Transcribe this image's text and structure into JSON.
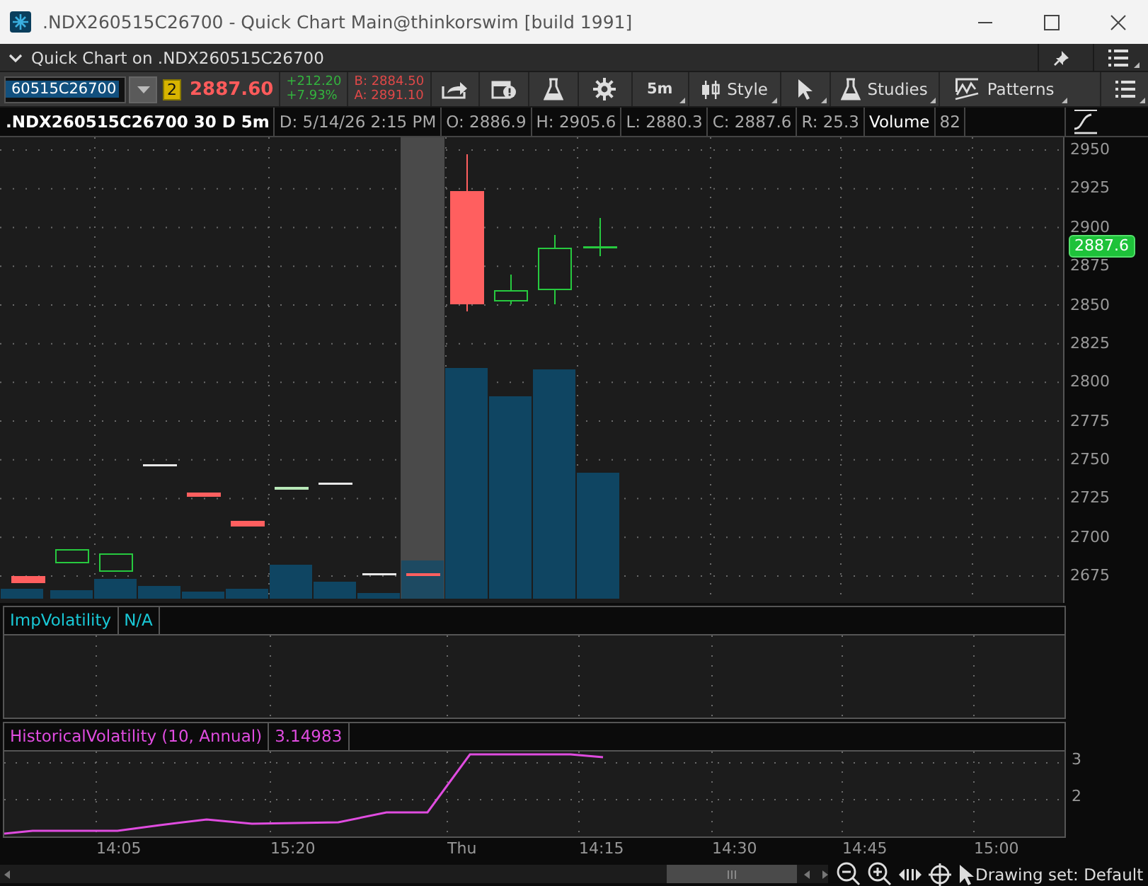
{
  "window": {
    "title": ".NDX260515C26700 - Quick Chart Main@thinkorswim [build 1991]"
  },
  "panel": {
    "title": "Quick Chart on .NDX260515C26700",
    "expanded": true
  },
  "quote": {
    "symbol": "60515C26700",
    "link_badge": "2",
    "last": "2887.60",
    "change": "+212.20",
    "change_pct": "+7.93%",
    "bid": "B: 2884.50",
    "ask": "A: 2891.10"
  },
  "tools": [
    {
      "kind": "share"
    },
    {
      "kind": "alert"
    },
    {
      "kind": "flask"
    },
    {
      "kind": "gear"
    },
    {
      "kind": "interval",
      "label": "5m"
    },
    {
      "kind": "style",
      "label": "Style"
    },
    {
      "kind": "cursor"
    },
    {
      "kind": "studies",
      "label": "Studies"
    },
    {
      "kind": "patterns",
      "label": "Patterns"
    },
    {
      "kind": "menu"
    }
  ],
  "info_bar": [
    {
      "text": ".NDX260515C26700 30 D 5m",
      "highlight": true
    },
    {
      "text": "D: 5/14/26 2:15 PM",
      "highlight": false
    },
    {
      "text": "O: 2886.9",
      "highlight": false
    },
    {
      "text": "H: 2905.6",
      "highlight": false
    },
    {
      "text": "L: 2880.3",
      "highlight": false
    },
    {
      "text": "C: 2887.6",
      "highlight": false
    },
    {
      "text": "R: 25.3",
      "highlight": false
    },
    {
      "text": "Volume",
      "highlight": true
    },
    {
      "text": "82",
      "highlight": false
    }
  ],
  "price_axis": {
    "ticks": [
      "2950",
      "2925",
      "2900",
      "2875",
      "2850",
      "2825",
      "2800",
      "2775",
      "2750",
      "2725",
      "2700",
      "2675"
    ],
    "last_price": "2887.6"
  },
  "studies": [
    {
      "name": "ImpVolatility",
      "value": "N/A"
    },
    {
      "name": "HistoricalVolatility (10, Annual)",
      "value": "3.14983",
      "axis": [
        "3",
        "2"
      ]
    }
  ],
  "time_axis": [
    "14:05",
    "15:20",
    "Thu",
    "14:15",
    "14:30",
    "14:45",
    "15:00"
  ],
  "status_bar": {
    "drawing_set": "Drawing set: Default"
  }
}
